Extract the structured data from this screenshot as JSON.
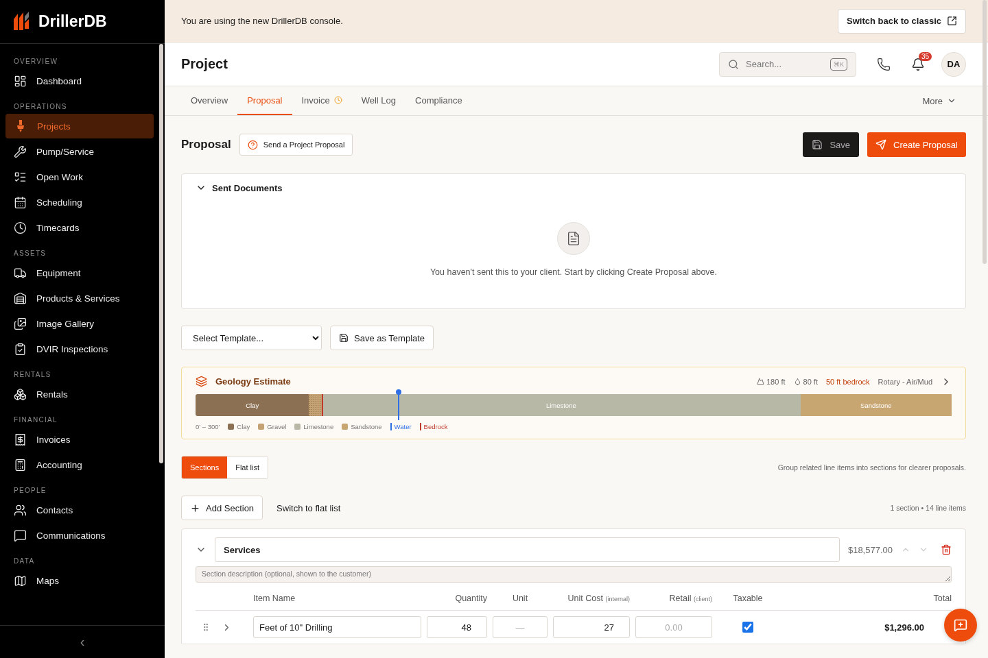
{
  "brand": "DrillerDB",
  "sidebar": {
    "groups": [
      {
        "label": "OVERVIEW",
        "items": [
          {
            "label": "Dashboard",
            "selected": false
          }
        ]
      },
      {
        "label": "OPERATIONS",
        "items": [
          {
            "label": "Projects",
            "selected": true
          },
          {
            "label": "Pump/Service",
            "selected": false
          },
          {
            "label": "Open Work",
            "selected": false
          },
          {
            "label": "Scheduling",
            "selected": false
          },
          {
            "label": "Timecards",
            "selected": false
          }
        ]
      },
      {
        "label": "ASSETS",
        "items": [
          {
            "label": "Equipment",
            "selected": false
          },
          {
            "label": "Products & Services",
            "selected": false
          },
          {
            "label": "Image Gallery",
            "selected": false
          },
          {
            "label": "DVIR Inspections",
            "selected": false
          }
        ]
      },
      {
        "label": "RENTALS",
        "items": [
          {
            "label": "Rentals",
            "selected": false
          }
        ]
      },
      {
        "label": "FINANCIAL",
        "items": [
          {
            "label": "Invoices",
            "selected": false
          },
          {
            "label": "Accounting",
            "selected": false
          }
        ]
      },
      {
        "label": "PEOPLE",
        "items": [
          {
            "label": "Contacts",
            "selected": false
          },
          {
            "label": "Communications",
            "selected": false
          }
        ]
      },
      {
        "label": "DATA",
        "items": [
          {
            "label": "Maps",
            "selected": false
          }
        ]
      }
    ],
    "collapse": "‹"
  },
  "banner": {
    "text": "You are using the new DrillerDB console.",
    "button": "Switch back to classic"
  },
  "header": {
    "title": "Project",
    "search": {
      "placeholder": "Search...",
      "shortcut": "⌘K"
    },
    "notifications": "35",
    "avatar": "DA"
  },
  "tabs": [
    {
      "label": "Overview",
      "selected": false,
      "pending": false
    },
    {
      "label": "Proposal",
      "selected": true,
      "pending": false
    },
    {
      "label": "Invoice",
      "selected": false,
      "pending": true
    },
    {
      "label": "Well Log",
      "selected": false,
      "pending": false
    },
    {
      "label": "Compliance",
      "selected": false,
      "pending": false
    }
  ],
  "more": "More",
  "proposal": {
    "title": "Proposal",
    "help": "Send a Project Proposal",
    "save": "Save",
    "create": "Create Proposal"
  },
  "sent_documents": {
    "title": "Sent Documents",
    "expanded": true,
    "empty": "You haven't sent this to your client. Start by clicking Create Proposal above."
  },
  "template": {
    "select": "Select Template...",
    "save": "Save as Template"
  },
  "geology": {
    "title": "Geology Estimate",
    "stats": [
      {
        "kind": "depth",
        "text": "180 ft"
      },
      {
        "kind": "water",
        "text": "80 ft"
      },
      {
        "kind": "bedrock",
        "text": "50 ft bedrock"
      },
      {
        "kind": "plain",
        "text": "Rotary - Air/Mud"
      }
    ],
    "layers": [
      {
        "label": "Clay",
        "color": "#8b7053"
      },
      {
        "color": "#c4a274"
      },
      {
        "label": "Limestone",
        "color": "#b8b8a6"
      },
      {
        "label": "Sandstone",
        "color": "#c8a672"
      }
    ],
    "markers": [
      {
        "kind": "bedrock",
        "color": "#c0392b"
      },
      {
        "kind": "water",
        "color": "#2f6fe6"
      }
    ],
    "range": "0' – 300'",
    "legend": [
      {
        "kind": "swatch",
        "label": "Clay",
        "color": "#8b7053"
      },
      {
        "kind": "swatch",
        "label": "Gravel",
        "color": "#c4a274"
      },
      {
        "kind": "swatch",
        "label": "Limestone",
        "color": "#b8b8a6"
      },
      {
        "kind": "swatch",
        "label": "Sandstone",
        "color": "#c8a672"
      },
      {
        "kind": "line",
        "label": "Water",
        "color": "#2f6fe6"
      },
      {
        "kind": "line",
        "label": "Bedrock",
        "color": "#c0392b"
      }
    ]
  },
  "view": {
    "options": [
      {
        "label": "Sections",
        "selected": true
      },
      {
        "label": "Flat list",
        "selected": false
      }
    ],
    "hint": "Group related line items into sections for clearer proposals."
  },
  "actions": {
    "add": "Add Section",
    "switch": "Switch to flat list",
    "summary": "1 section • 14 line items"
  },
  "section": {
    "expanded": true,
    "name": "Services",
    "total": "$18,577.00",
    "description_placeholder": "Section description (optional, shown to the customer)",
    "columns": [
      {
        "label": "Item Name"
      },
      {
        "label": "Quantity"
      },
      {
        "label": "Unit"
      },
      {
        "label": "Unit Cost",
        "note": "(internal)"
      },
      {
        "label": "Retail",
        "note": "(client)"
      },
      {
        "label": "Taxable"
      },
      {
        "label": "Total"
      }
    ],
    "rows": [
      {
        "expanded": false,
        "name": "Feet of 10\" Drilling",
        "quantity": "48",
        "unit_placeholder": "—",
        "unit_cost": "27",
        "retail_placeholder": "0.00",
        "taxable": true,
        "total": "$1,296.00"
      }
    ]
  }
}
